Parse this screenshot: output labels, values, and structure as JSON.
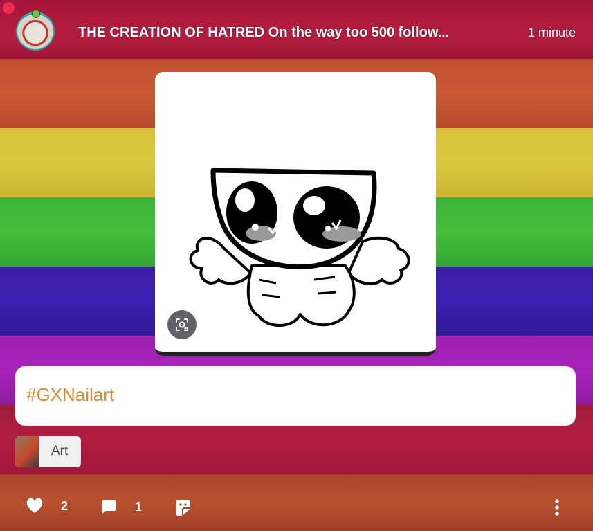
{
  "post": {
    "title": "THE CREATION OF HATRED On the way too 500 follow...",
    "time": "1 minute"
  },
  "tags": {
    "hashtag": "#GXNailart"
  },
  "category": {
    "label": "Art"
  },
  "actions": {
    "likes": "2",
    "comments": "1"
  },
  "icons": {
    "like": "heart-icon",
    "comment": "speech-bubble-icon",
    "share": "sticker-icon",
    "more": "kebab-menu-icon",
    "lens": "image-search-icon"
  },
  "colors": {
    "hashtag": "#e08a2f",
    "notification_dot": "#ee2a4e"
  }
}
